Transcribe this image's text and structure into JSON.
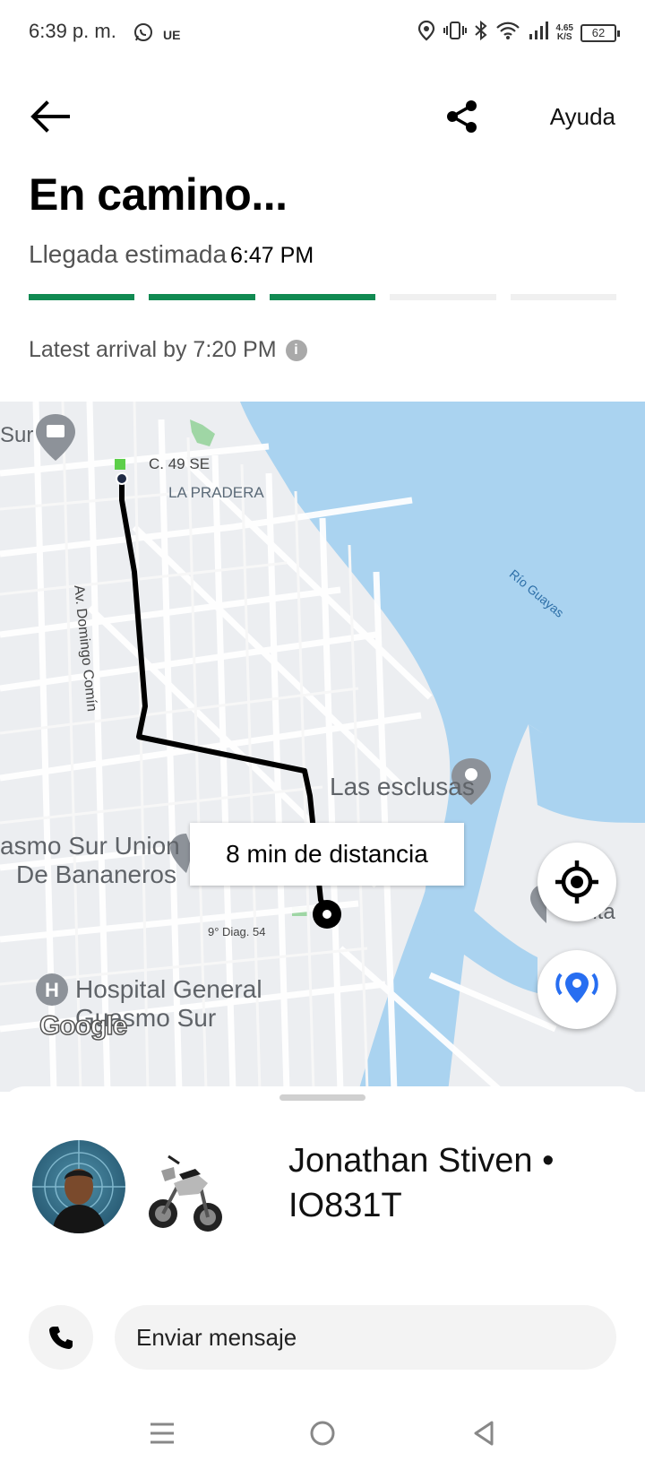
{
  "status_bar": {
    "time": "6:39 p. m.",
    "ue": "UE",
    "speed_value": "4.65",
    "speed_unit": "K/S",
    "battery": "62"
  },
  "header": {
    "help_label": "Ayuda"
  },
  "trip": {
    "title": "En camino...",
    "eta_label": "Llegada estimada",
    "eta_time": "6:47 PM",
    "progress_segments": 5,
    "progress_completed": 3,
    "latest_arrival": "Latest arrival by 7:20 PM",
    "accent_color": "#118a52"
  },
  "map": {
    "labels": {
      "street_north": "C. 49 SE",
      "neighborhood": "LA PRADERA",
      "avenue": "Av. Domingo Comín",
      "river": "Río Guayas",
      "poi_esclusas": "Las esclusas",
      "poi_union_1": "asmo Sur Union",
      "poi_union_2": "De Bananeros",
      "diag": "9° Diag. 54",
      "hospital_1": "Hospital General",
      "hospital_2": "Guasmo Sur",
      "partial_left": "Sur",
      "partial_right": "arita",
      "google": "Google"
    },
    "eta_bubble": "8 min de distancia",
    "route_color": "#000000",
    "water_color": "#aad3f0"
  },
  "driver": {
    "name_line1": "Jonathan Stiven •",
    "plate": "IO831T"
  },
  "actions": {
    "message_placeholder": "Enviar mensaje"
  }
}
